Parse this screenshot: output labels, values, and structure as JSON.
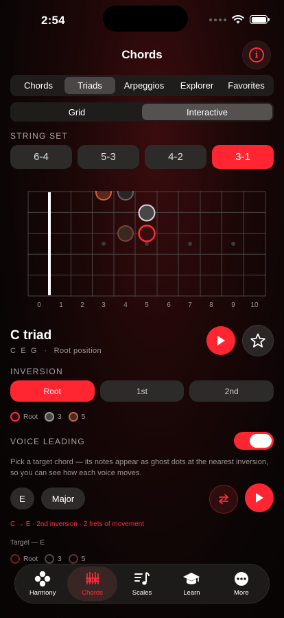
{
  "status": {
    "time": "2:54"
  },
  "header": {
    "title": "Chords"
  },
  "top_tabs": [
    {
      "label": "Chords",
      "active": false
    },
    {
      "label": "Triads",
      "active": true
    },
    {
      "label": "Arpeggios",
      "active": false
    },
    {
      "label": "Explorer",
      "active": false
    },
    {
      "label": "Favorites",
      "active": false
    }
  ],
  "view_mode": {
    "options": [
      "Grid",
      "Interactive"
    ],
    "selected": "Interactive"
  },
  "string_set": {
    "label": "STRING SET",
    "options": [
      "6-4",
      "5-3",
      "4-2",
      "3-1"
    ],
    "selected": "3-1"
  },
  "fretboard": {
    "fret_numbers": [
      "0",
      "1",
      "2",
      "3",
      "4",
      "5",
      "6",
      "7",
      "8",
      "9",
      "10"
    ],
    "inlay_frets": [
      3,
      5,
      7,
      9
    ],
    "notes": [
      {
        "string": 1,
        "fret": 3,
        "role": "root"
      },
      {
        "string": 1,
        "fret": 4,
        "role": "third-ghost"
      },
      {
        "string": 2,
        "fret": 5,
        "role": "third"
      },
      {
        "string": 3,
        "fret": 4,
        "role": "fifth"
      },
      {
        "string": 3,
        "fret": 5,
        "role": "root"
      }
    ]
  },
  "chord": {
    "name": "C triad",
    "notes_line": "C  E  G   ·   Root position"
  },
  "inversion": {
    "label": "INVERSION",
    "options": [
      "Root",
      "1st",
      "2nd"
    ],
    "selected": "Root"
  },
  "legend": [
    {
      "label": "Root",
      "color": "#ff2d3a"
    },
    {
      "label": "3",
      "color": "#9a9a9a"
    },
    {
      "label": "5",
      "color": "#c2674a"
    }
  ],
  "voice_leading": {
    "label": "VOICE LEADING",
    "enabled": true,
    "description": "Pick a target chord — its notes appear as ghost dots at the nearest inversion, so you can see how each voice moves.",
    "target_root": "E",
    "target_quality": "Major",
    "movement": "C → E · 2nd inversion · 2 frets of movement",
    "target_label": "Target — E"
  },
  "target_legend": [
    {
      "label": "Root",
      "color": "#7a1a20"
    },
    {
      "label": "3",
      "color": "#4a4a4a"
    },
    {
      "label": "5",
      "color": "#5a3428"
    }
  ],
  "tab_bar": [
    {
      "label": "Harmony",
      "icon": "harmony-icon",
      "active": false
    },
    {
      "label": "Chords",
      "icon": "chords-icon",
      "active": true
    },
    {
      "label": "Scales",
      "icon": "scales-icon",
      "active": false
    },
    {
      "label": "Learn",
      "icon": "graduation-cap-icon",
      "active": false
    },
    {
      "label": "More",
      "icon": "more-icon",
      "active": false
    }
  ],
  "colors": {
    "accent": "#ff2631",
    "surface": "#2d2a2a",
    "background": "#0b0505"
  }
}
